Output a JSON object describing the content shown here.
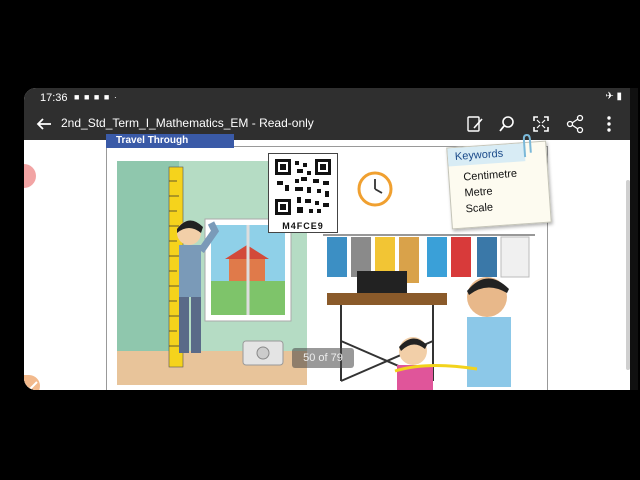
{
  "status_bar": {
    "time": "17:36",
    "notification_icons": [
      "video-icon",
      "lock-icon",
      "shield-icon",
      "app-icon",
      "dot-icon"
    ],
    "right_icons": [
      "airplane-icon",
      "battery-icon"
    ]
  },
  "app_bar": {
    "title": "2nd_Std_Term_I_Mathematics_EM - Read-only",
    "actions": [
      "edit-icon",
      "search-icon",
      "fullscreen-icon",
      "share-icon",
      "more-icon"
    ]
  },
  "page": {
    "banner_text": "Travel Through",
    "qr_code_label": "M4FCE9",
    "keywords": {
      "title": "Keywords",
      "items": [
        "Centimetre",
        "Metre",
        "Scale"
      ]
    },
    "page_indicator": "50 of 79"
  }
}
